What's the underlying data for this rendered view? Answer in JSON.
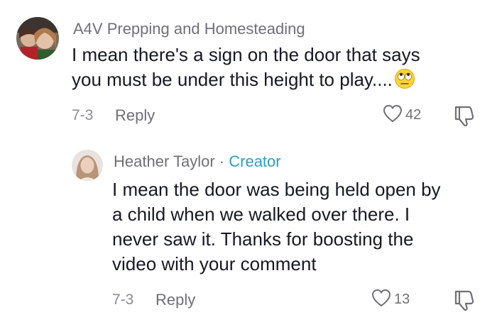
{
  "comments": [
    {
      "author": "A4V Prepping and Homesteading",
      "text_lines": [
        "I mean there's a sign on the door that says",
        "you must be under this height to play...."
      ],
      "emoji": "face-with-rolling-eyes",
      "date": "7-3",
      "reply_label": "Reply",
      "likes": "42"
    },
    {
      "author": "Heather Taylor",
      "separator": "·",
      "badge": "Creator",
      "text_lines": [
        "I mean the door was being held open by",
        "a child when we walked over there. I",
        "never saw it. Thanks for boosting the",
        "video with your comment"
      ],
      "date": "7-3",
      "reply_label": "Reply",
      "likes": "13"
    }
  ],
  "colors": {
    "text": "#161823",
    "secondary": "#6f7077",
    "creator_badge": "#2b9ec5"
  }
}
